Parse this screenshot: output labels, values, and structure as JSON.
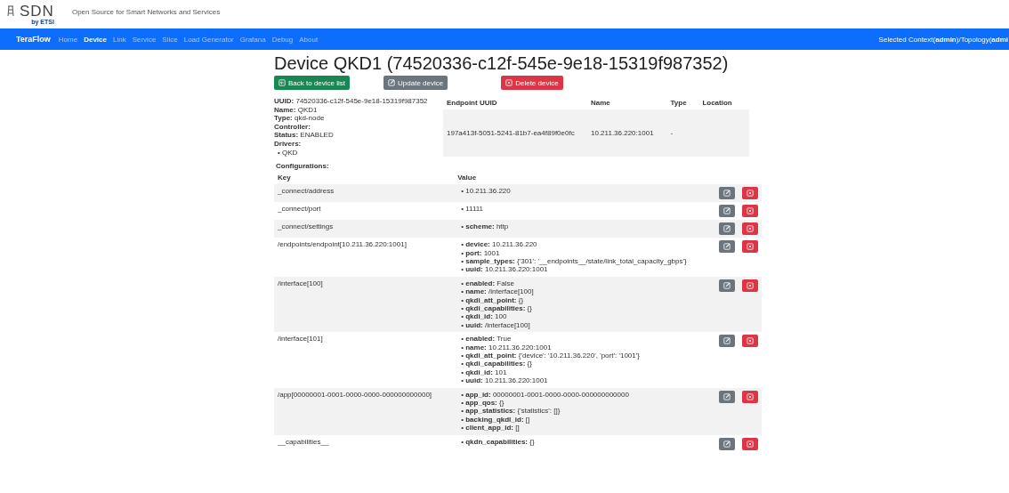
{
  "header": {
    "logo": "SDN",
    "logo_sub": "by ETSI",
    "tagline": "Open Source for Smart Networks and Services"
  },
  "nav": {
    "brand": "TeraFlow",
    "items": [
      {
        "label": "Home",
        "selected": false
      },
      {
        "label": "Device",
        "selected": true
      },
      {
        "label": "Link",
        "selected": false
      },
      {
        "label": "Service",
        "selected": false
      },
      {
        "label": "Slice",
        "selected": false
      },
      {
        "label": "Load Generator",
        "selected": false
      },
      {
        "label": "Grafana",
        "selected": false
      },
      {
        "label": "Debug",
        "selected": false
      },
      {
        "label": "About",
        "selected": false
      }
    ],
    "context": "Selected Context(**admin**)/Topology(**admi**"
  },
  "title": "Device QKD1 (74520336-c12f-545e-9e18-15319f987352)",
  "buttons": [
    {
      "kind": "back",
      "label": "Back to device list"
    },
    {
      "kind": "update",
      "label": "Update device"
    },
    {
      "kind": "delete",
      "label": "Delete device"
    }
  ],
  "details": [
    "**UUID:** 74520336-c12f-545e-9e18-15319f987352",
    "**Name:** QKD1",
    "**Type:** qkd-node",
    "**Controller:**",
    "**Status:** ENABLED",
    "**Drivers:**"
  ],
  "drivers": [
    "• QKD"
  ],
  "endpoints": {
    "columns": [
      "Endpoint UUID",
      "Name",
      "Type",
      "Location"
    ],
    "rows": [
      [
        "197a413f-5051-5241-81b7-ea4f89f0e0fc",
        "10.211.36.220:1001",
        "-"
      ]
    ]
  },
  "configurations": {
    "title": "Configurations:",
    "columns": [
      "Key",
      "Value"
    ],
    "rows": [
      {
        "key": "_connect/address",
        "values": [
          "• 10.211.36.220"
        ]
      },
      {
        "key": "_connect/port",
        "values": [
          "• 11111"
        ]
      },
      {
        "key": "_connect/settings",
        "values": [
          "• **scheme:** http"
        ]
      },
      {
        "key": "/endpoints/endpoint[10.211.36.220:1001]",
        "values": [
          "• **device:** 10.211.36.220",
          "• **port:** 1001",
          "• **sample_types:** {'301': '__endpoints__/state/link_total_capacity_gbps'}",
          "• **uuid:** 10.211.36.220:1001"
        ]
      },
      {
        "key": "/interface[100]",
        "values": [
          "• **enabled:** False",
          "• **name:** /interface[100]",
          "• **qkdi_att_point:** {}",
          "• **qkdi_capabilities:** {}",
          "• **qkdi_id:** 100",
          "• **uuid:** /interface[100]"
        ]
      },
      {
        "key": "/interface[101]",
        "values": [
          "• **enabled:** True",
          "• **name:** 10.211.36.220:1001",
          "• **qkdi_att_point:** {'device': '10.211.36.220', 'port': '1001'}",
          "• **qkdi_capabilities:** {}",
          "• **qkdi_id:** 101",
          "• **uuid:** 10.211.36.220:1001"
        ]
      },
      {
        "key": "/app[00000001-0001-0000-0000-000000000000]",
        "values": [
          "• **app_id:** 00000001-0001-0000-0000-000000000000",
          "• **app_qos:** {}",
          "• **app_statistics:** {'statistics': []}",
          "• **backing_qkdl_id:** []",
          "• **client_app_id:** []"
        ]
      },
      {
        "key": "__capabilities__",
        "values": [
          "• **qkdn_capabilities:** {}"
        ]
      }
    ]
  }
}
